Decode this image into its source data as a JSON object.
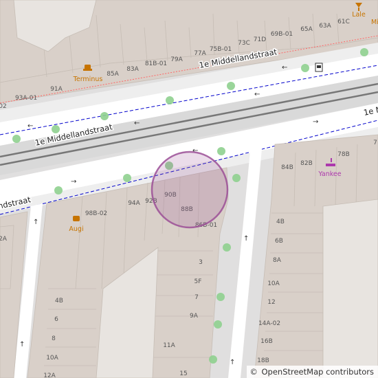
{
  "map": {
    "streets": [
      {
        "id": "street-top",
        "label": "1e Middellandstraat"
      },
      {
        "id": "street-main-left",
        "label": "1e Middellandstraat"
      },
      {
        "id": "street-main-right",
        "label": "1e M"
      },
      {
        "id": "street-lower-left",
        "label": "ndstraat"
      }
    ],
    "pois": [
      {
        "id": "poi-terminus",
        "label": "Terminus",
        "icon": "fastfood-icon",
        "color": "#c77400"
      },
      {
        "id": "poi-augi",
        "label": "Augi",
        "icon": "fastfood-icon",
        "color": "#c77400"
      },
      {
        "id": "poi-yankee",
        "label": "Yankee",
        "icon": "smoking-shop-icon",
        "color": "#ac39ac"
      },
      {
        "id": "poi-lale",
        "label": "Lale",
        "icon": "bar-icon",
        "color": "#c77400"
      },
      {
        "id": "poi-midd",
        "label": "Midd",
        "icon": "bar-icon",
        "color": "#c77400"
      }
    ],
    "house_numbers": [
      "73C",
      "71D",
      "69B-01",
      "65A",
      "63A",
      "61C",
      "75B-01",
      "77A",
      "79A",
      "81B-01",
      "83A",
      "85A",
      "91A",
      "93A-01",
      "02",
      "84B",
      "82B",
      "78B",
      "7",
      "92B",
      "94A",
      "98B-02",
      "90B",
      "88B",
      "86B-01",
      "3",
      "5F",
      "7",
      "9A",
      "11A",
      "15",
      "4B",
      "6B",
      "8A",
      "10A",
      "12",
      "14A-02",
      "16B",
      "18B",
      "4B",
      "6",
      "8",
      "10A",
      "12A",
      "2A"
    ],
    "accent_colors": {
      "selection_circle": "#9b4f96",
      "bus_route": "#0000cc",
      "tram_route": "#ff6666",
      "tree": "#8fd08f"
    },
    "attribution": {
      "symbol": "©",
      "text": "OpenStreetMap contributors"
    }
  }
}
